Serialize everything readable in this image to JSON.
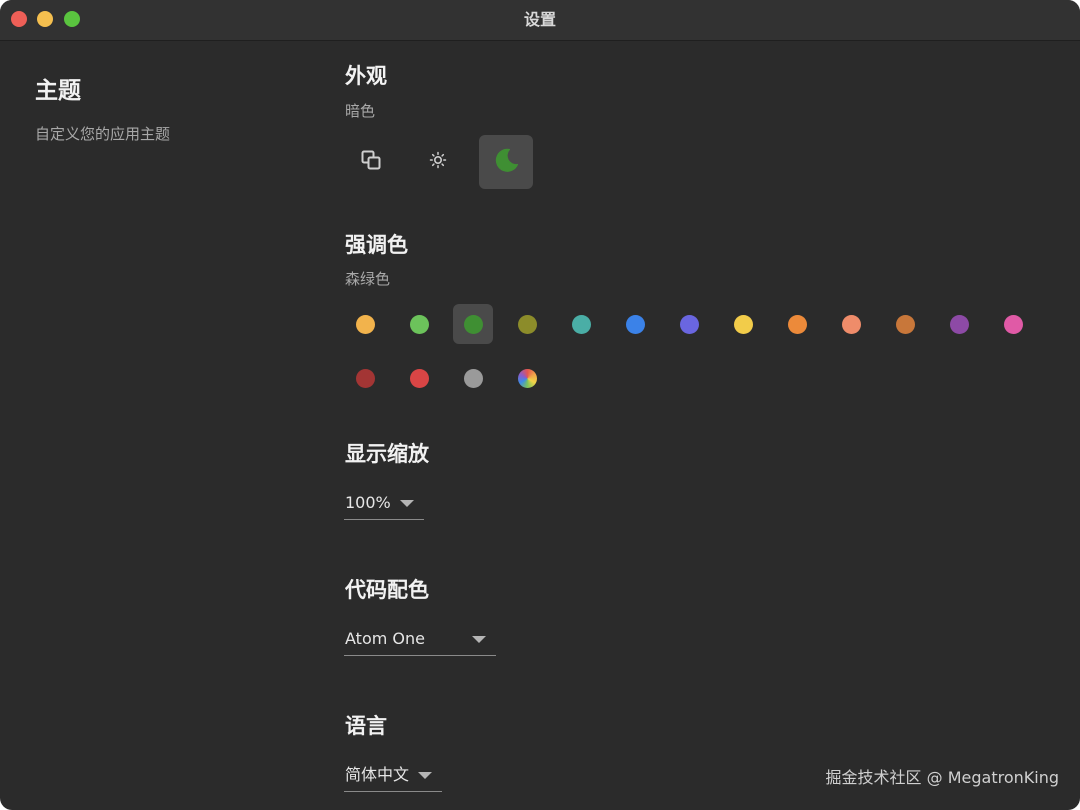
{
  "window": {
    "title": "设置"
  },
  "sidebar": {
    "title": "主题",
    "description": "自定义您的应用主题"
  },
  "appearance": {
    "title": "外观",
    "current": "暗色",
    "modes": [
      {
        "icon": "system-mode-icon",
        "selected": false
      },
      {
        "icon": "sun-icon",
        "selected": false
      },
      {
        "icon": "moon-icon",
        "selected": true
      }
    ]
  },
  "accent": {
    "title": "强调色",
    "current": "森绿色",
    "colors": [
      "#f2b34c",
      "#6cc35b",
      "#3f8f33",
      "#8c8c2a",
      "#4aaea6",
      "#3b82e8",
      "#6a66e0",
      "#f2cc4a",
      "#ec8a3a",
      "#ef8c6a",
      "#c8773a",
      "#8d4aa6",
      "#e05aa6",
      "#a33534",
      "#d94545",
      "#9a9a9a",
      "rainbow"
    ],
    "selected_index": 2
  },
  "zoom": {
    "title": "显示缩放",
    "value": "100%"
  },
  "code_theme": {
    "title": "代码配色",
    "value": "Atom One"
  },
  "language": {
    "title": "语言",
    "value": "简体中文"
  },
  "watermark": "掘金技术社区 @ MegatronKing"
}
